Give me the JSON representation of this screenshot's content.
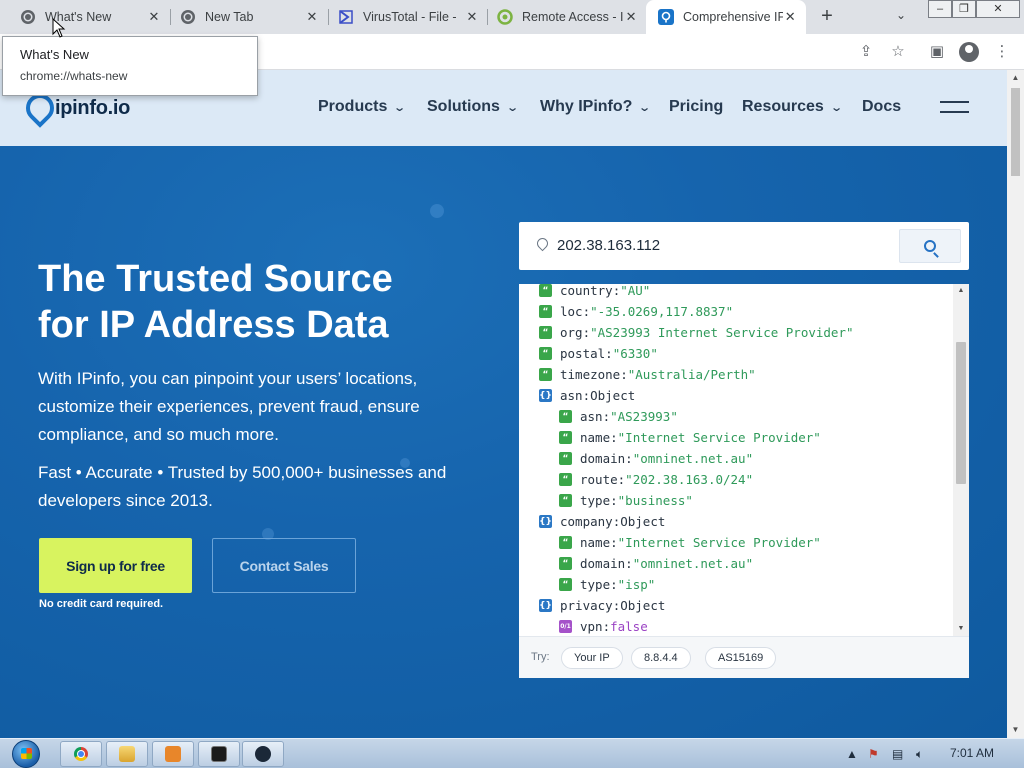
{
  "browser": {
    "tabs": [
      {
        "label": "What's New",
        "icon": "chrome-icon",
        "active": false
      },
      {
        "label": "New Tab",
        "icon": "chrome-icon",
        "active": false
      },
      {
        "label": "VirusTotal - File - ",
        "icon": "virustotal-icon",
        "active": false
      },
      {
        "label": "Remote Access - I",
        "icon": "remote-access-icon",
        "active": false
      },
      {
        "label": "Comprehensive IP",
        "icon": "ipinfo-icon",
        "active": true
      }
    ],
    "new_tab_symbol": "+",
    "tab_search_symbol": "⌄",
    "tooltip": {
      "title": "What's New",
      "url": "chrome://whats-new"
    }
  },
  "site": {
    "logo_text": "ipinfo.io",
    "nav": [
      "Products",
      "Solutions",
      "Why IPinfo?",
      "Pricing",
      "Resources",
      "Docs"
    ],
    "hero": {
      "title_line1": "The Trusted Source",
      "title_line2": "for IP Address Data",
      "lead": "With IPinfo, you can pinpoint your users’ locations, customize their experiences, prevent fraud, ensure compliance, and so much more.",
      "sub": "Fast • Accurate • Trusted by 500,000+ businesses and developers since 2013.",
      "cta_primary": "Sign up for free",
      "cta_secondary": "Contact Sales",
      "note": "No credit card required."
    },
    "lookup": {
      "ip": "202.38.163.112",
      "lines": [
        {
          "indent": 0,
          "type": "str",
          "key": "country",
          "value": "\"AU\""
        },
        {
          "indent": 0,
          "type": "str",
          "key": "loc",
          "value": "\"-35.0269,117.8837\""
        },
        {
          "indent": 0,
          "type": "str",
          "key": "org",
          "value": "\"AS23993 Internet Service Provider\""
        },
        {
          "indent": 0,
          "type": "str",
          "key": "postal",
          "value": "\"6330\""
        },
        {
          "indent": 0,
          "type": "str",
          "key": "timezone",
          "value": "\"Australia/Perth\""
        },
        {
          "indent": 0,
          "type": "obj",
          "key": "asn",
          "value": "Object"
        },
        {
          "indent": 1,
          "type": "str",
          "key": "asn",
          "value": "\"AS23993\""
        },
        {
          "indent": 1,
          "type": "str",
          "key": "name",
          "value": "\"Internet Service Provider\""
        },
        {
          "indent": 1,
          "type": "str",
          "key": "domain",
          "value": "\"omninet.net.au\""
        },
        {
          "indent": 1,
          "type": "str",
          "key": "route",
          "value": "\"202.38.163.0/24\""
        },
        {
          "indent": 1,
          "type": "str",
          "key": "type",
          "value": "\"business\""
        },
        {
          "indent": 0,
          "type": "obj",
          "key": "company",
          "value": "Object"
        },
        {
          "indent": 1,
          "type": "str",
          "key": "name",
          "value": "\"Internet Service Provider\""
        },
        {
          "indent": 1,
          "type": "str",
          "key": "domain",
          "value": "\"omninet.net.au\""
        },
        {
          "indent": 1,
          "type": "str",
          "key": "type",
          "value": "\"isp\""
        },
        {
          "indent": 0,
          "type": "obj",
          "key": "privacy",
          "value": "Object"
        },
        {
          "indent": 1,
          "type": "bool",
          "key": "vpn",
          "value": "false"
        }
      ],
      "badge_symbols": {
        "str": "“",
        "obj": "{}",
        "bool": "0/1"
      },
      "try_label": "Try:",
      "try_chips": [
        "Your IP",
        "8.8.4.4",
        "AS15169"
      ]
    }
  },
  "taskbar": {
    "clock": "7:01 AM",
    "apps": [
      "chrome-icon",
      "explorer-icon",
      "media-player-icon",
      "cmd-icon",
      "steam-icon"
    ]
  },
  "colors": {
    "hero_bg": "#1664ad",
    "nav_bg": "#dce9f6",
    "cta_primary": "#d8f35f",
    "json_string": "#2f9a5a",
    "json_bool": "#9b43c4"
  }
}
